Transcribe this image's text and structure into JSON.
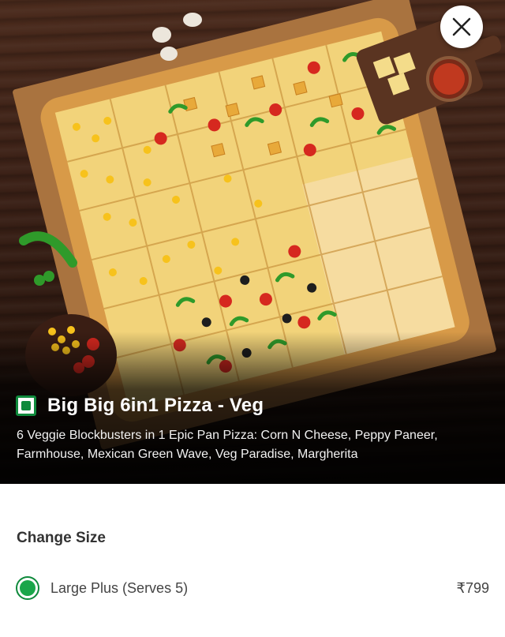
{
  "product": {
    "title": "Big Big 6in1 Pizza - Veg",
    "description": "6 Veggie Blockbusters in 1 Epic Pan Pizza: Corn N Cheese, Peppy Paneer, Farmhouse, Mexican Green Wave, Veg Paradise, Margherita",
    "veg_icon": "veg-indicator-icon",
    "close_icon": "close-icon"
  },
  "size_section": {
    "heading": "Change Size",
    "options": [
      {
        "label": "Large Plus (Serves 5)",
        "price": "₹799",
        "selected": true
      }
    ]
  },
  "colors": {
    "veg_green": "#0f8a3c",
    "radio_green": "#1aa64a",
    "text_dark": "#333333"
  }
}
